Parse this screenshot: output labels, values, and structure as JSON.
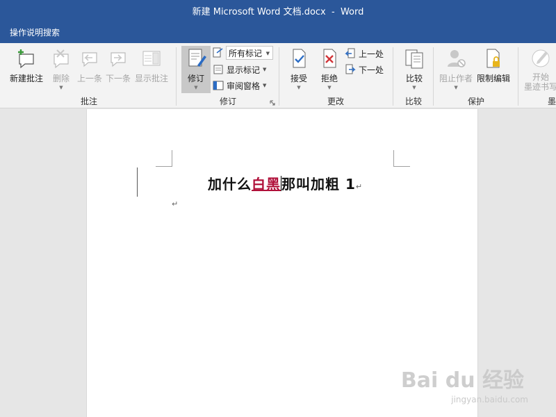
{
  "titlebar": {
    "title": "新建 Microsoft Word 文档.docx  -  Word"
  },
  "tellme": {
    "label": "操作说明搜索"
  },
  "groups": {
    "comments": {
      "label": "批注",
      "new": "新建批注",
      "delete": "删除",
      "prev": "上一条",
      "next": "下一条",
      "show": "显示批注"
    },
    "tracking": {
      "label": "修订",
      "track": "修订",
      "markup": "所有标记",
      "show_markup": "显示标记",
      "pane": "审阅窗格"
    },
    "changes": {
      "label": "更改",
      "accept": "接受",
      "reject": "拒绝",
      "prev": "上一处",
      "next": "下一处"
    },
    "compare": {
      "label": "比较",
      "compare": "比较"
    },
    "protect": {
      "label": "保护",
      "block": "阻止作者",
      "restrict": "限制编辑"
    },
    "ink": {
      "label": "墨",
      "start_line1": "开始",
      "start_line2": "墨迹书写"
    }
  },
  "document": {
    "before": "加什么",
    "inserted": "白黑",
    "after": "那叫加粗 1",
    "para_mark": "↵"
  },
  "watermark": {
    "brand": "Bai du 经验",
    "url": "jingyan.baidu.com"
  },
  "colors": {
    "titlebar": "#2b579a",
    "insertion": "#b0103a"
  }
}
